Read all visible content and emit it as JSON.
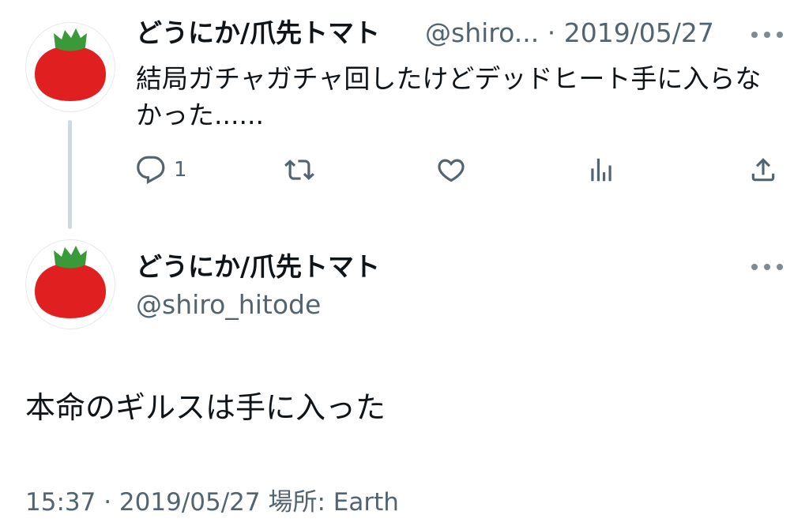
{
  "reply_tweet": {
    "display_name": "どうにか/爪先トマト",
    "handle_truncated": "@shiro...",
    "separator": "·",
    "date": "2019/05/27",
    "text": "結局ガチャガチャ回したけどデッドヒート手に入らなかった......",
    "actions": {
      "reply_count": "1",
      "icons": [
        "reply-icon",
        "retweet-icon",
        "like-icon",
        "analytics-icon",
        "share-icon"
      ]
    }
  },
  "main_tweet": {
    "display_name": "どうにか/爪先トマト",
    "handle": "@shiro_hitode",
    "text": "本命のギルスは手に入った",
    "time": "15:37",
    "separator": "·",
    "date": "2019/05/27",
    "location_label": "場所: Earth"
  },
  "colors": {
    "text": "#0f1419",
    "secondary": "#536471",
    "thread_line": "#cfd9de",
    "avatar_tomato": "#e02020",
    "avatar_leaf": "#3a9a3a"
  }
}
